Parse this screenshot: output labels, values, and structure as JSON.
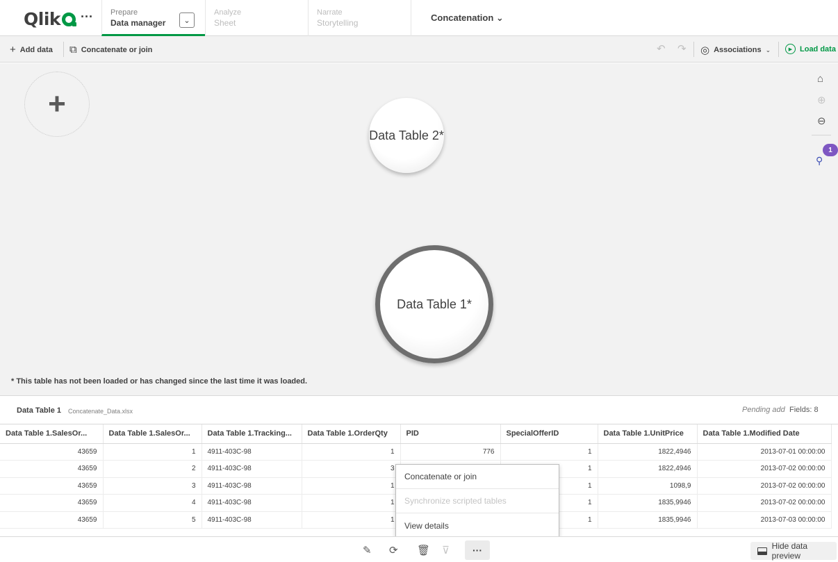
{
  "brand": {
    "logo_text": "Qlik",
    "accent": "#009845"
  },
  "nav": {
    "more_label": "···",
    "prepare": {
      "small": "Prepare",
      "big": "Data manager"
    },
    "prepare_dropdown": "⌄",
    "analyze": {
      "small": "Analyze",
      "big": "Sheet"
    },
    "narrate": {
      "small": "Narrate",
      "big": "Storytelling"
    },
    "app_title": "Concatenation ⌄"
  },
  "toolbar": {
    "add_data": "Add data",
    "concatenate": "Concatenate or join",
    "associations": "Associations",
    "load_data": "Load data"
  },
  "canvas": {
    "add_symbol": "+",
    "tables": [
      "Data Table 2*",
      "Data Table 1*"
    ],
    "badge_count": "1",
    "footnote": "* This table has not been loaded or has changed since the last time it was loaded."
  },
  "preview": {
    "table_name": "Data Table 1",
    "file_name": "Concatenate_Data.xlsx",
    "status": "Pending add",
    "fields": "Fields: 8",
    "columns": [
      "Data Table 1.SalesOr...",
      "Data Table 1.SalesOr...",
      "Data Table 1.Tracking...",
      "Data Table 1.OrderQty",
      "PID",
      "SpecialOfferID",
      "Data Table 1.UnitPrice",
      "Data Table 1.Modified Date"
    ],
    "rows": [
      [
        "43659",
        "1",
        "4911-403C-98",
        "1",
        "776",
        "1",
        "1822,4946",
        "2013-07-01 00:00:00"
      ],
      [
        "43659",
        "2",
        "4911-403C-98",
        "3",
        "",
        "1",
        "1822,4946",
        "2013-07-02 00:00:00"
      ],
      [
        "43659",
        "3",
        "4911-403C-98",
        "1",
        "",
        "1",
        "1098,9",
        "2013-07-02 00:00:00"
      ],
      [
        "43659",
        "4",
        "4911-403C-98",
        "1",
        "",
        "1",
        "1835,9946",
        "2013-07-02 00:00:00"
      ],
      [
        "43659",
        "5",
        "4911-403C-98",
        "1",
        "",
        "1",
        "1835,9946",
        "2013-07-03 00:00:00"
      ]
    ]
  },
  "context_menu": {
    "items": [
      "Concatenate or join",
      "Synchronize scripted tables",
      "View details"
    ]
  },
  "bottombar": {
    "more_label": "···",
    "hide_preview": "Hide data preview"
  }
}
